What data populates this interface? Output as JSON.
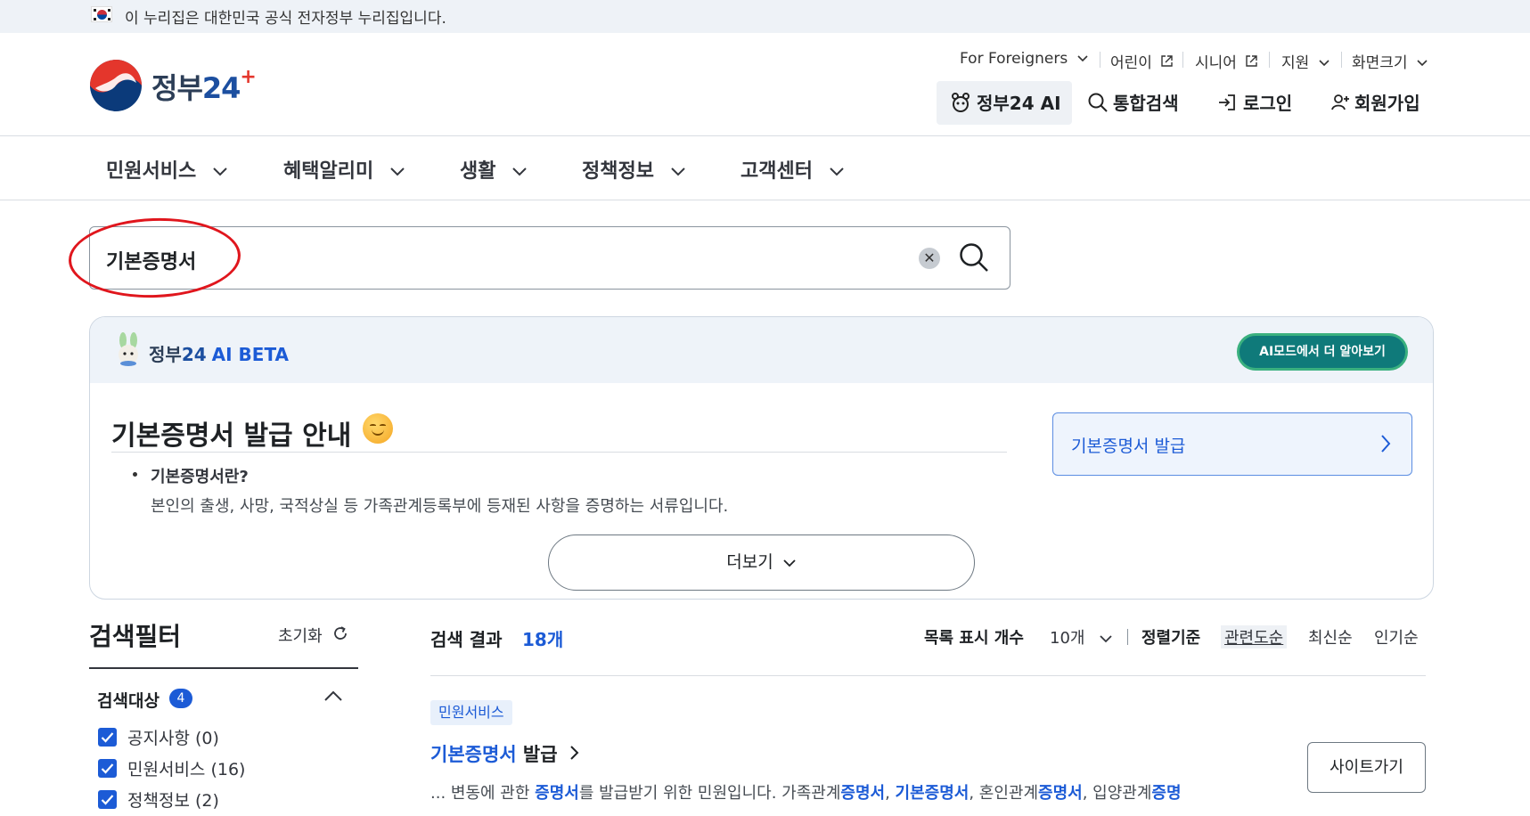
{
  "gov_banner": {
    "text": "이 누리집은 대한민국 공식 전자정부 누리집입니다."
  },
  "logo": {
    "text_main": "정부",
    "text_num": "24"
  },
  "util_menu": [
    {
      "label": "For Foreigners",
      "icon": "chevron-down-icon"
    },
    {
      "label": "어린이",
      "icon": "external-link-icon"
    },
    {
      "label": "시니어",
      "icon": "external-link-icon"
    },
    {
      "label": "지원",
      "icon": "chevron-down-icon"
    },
    {
      "label": "화면크기",
      "icon": "chevron-down-icon"
    }
  ],
  "header_buttons": {
    "ai": "정부24 AI",
    "search": "통합검색",
    "login": "로그인",
    "signup": "회원가입"
  },
  "gnb": [
    "민원서비스",
    "혜택알리미",
    "생활",
    "정책정보",
    "고객센터"
  ],
  "search": {
    "value": "기본증명서"
  },
  "ai_panel": {
    "logo_main": "정부",
    "logo_num": "24",
    "beta": "AI BETA",
    "mode_button": "AI모드에서 더 알아보기",
    "title": "기본증명서 발급 안내",
    "question": "기본증명서란?",
    "answer": "본인의 출생, 사망, 국적상실 등 가족관계등록부에 등재된 사항을 증명하는 서류입니다.",
    "more_button": "더보기",
    "card_label": "기본증명서 발급"
  },
  "filter": {
    "title": "검색필터",
    "reset": "초기화",
    "target_label": "검색대상",
    "target_count": "4",
    "options": [
      {
        "label": "공지사항 (0)",
        "checked": true
      },
      {
        "label": "민원서비스 (16)",
        "checked": true
      },
      {
        "label": "정책정보 (2)",
        "checked": true
      }
    ]
  },
  "results": {
    "label": "검색 결과",
    "count": "18개",
    "list_count_label": "목록 표시 개수",
    "list_count_value": "10개",
    "sort_label": "정렬기준",
    "sort_options": [
      "관련도순",
      "최신순",
      "인기순"
    ],
    "sort_active": "관련도순",
    "items": [
      {
        "category": "민원서비스",
        "title_highlight": "기본증명서",
        "title_rest": " 발급",
        "desc_parts": [
          {
            "t": "... 변동에 관한 ",
            "hl": false
          },
          {
            "t": "증명서",
            "hl": true
          },
          {
            "t": "를 발급받기 위한 민원입니다. 가족관계",
            "hl": false
          },
          {
            "t": "증명서",
            "hl": true
          },
          {
            "t": ", ",
            "hl": false
          },
          {
            "t": "기본증명서",
            "hl": true
          },
          {
            "t": ", 혼인관계",
            "hl": false
          },
          {
            "t": "증명서",
            "hl": true
          },
          {
            "t": ", 입양관계",
            "hl": false
          },
          {
            "t": "증명",
            "hl": true
          }
        ],
        "site_button": "사이트가기"
      }
    ]
  },
  "colors": {
    "primary": "#1c5bd6",
    "highlight_oval": "#e0161d",
    "ai_mode_button": "#0f7a7a"
  }
}
